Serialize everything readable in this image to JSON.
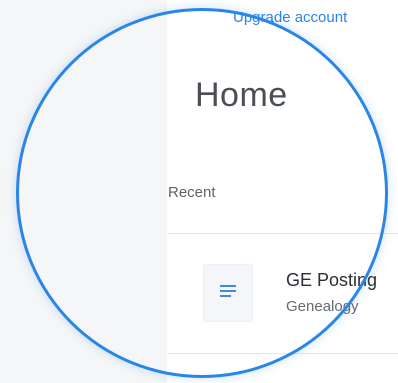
{
  "header": {
    "upgrade_link": "Upgrade account"
  },
  "main": {
    "title": "Home",
    "recent_label": "Recent",
    "files": [
      {
        "name": "GE Posting",
        "subtitle": "Genealogy",
        "icon": "document-lines-icon"
      }
    ]
  },
  "colors": {
    "accent": "#2c83e6",
    "lens_ring": "#2a86e6",
    "icon": "#4a86d6",
    "page_bg": "#f5f6f7",
    "panel_bg": "#ffffff"
  }
}
